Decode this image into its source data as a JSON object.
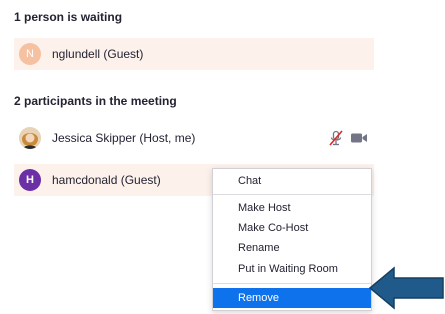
{
  "waiting": {
    "title": "1 person is waiting",
    "person": {
      "initial": "N",
      "name": "nglundell (Guest)"
    }
  },
  "meeting": {
    "title": "2 participants in the meeting",
    "participants": [
      {
        "name": "Jessica Skipper (Host, me)",
        "avatar": "photo",
        "icons": [
          "muted-mic-icon",
          "video-camera-icon"
        ]
      },
      {
        "initial": "H",
        "name": "hamcdonald (Guest)",
        "avatar": "initial"
      }
    ]
  },
  "context_menu": {
    "items": [
      "Chat",
      "Make Host",
      "Make Co-Host",
      "Rename",
      "Put in Waiting Room",
      "Remove"
    ],
    "selected": "Remove"
  },
  "colors": {
    "highlight_row": "#fdf1eb",
    "menu_active": "#0e72ed",
    "avatar_peach": "#f6c1a1",
    "avatar_purple": "#6b2fa6",
    "mute_red": "#e02828",
    "arrow_blue": "#1f5a8a"
  }
}
